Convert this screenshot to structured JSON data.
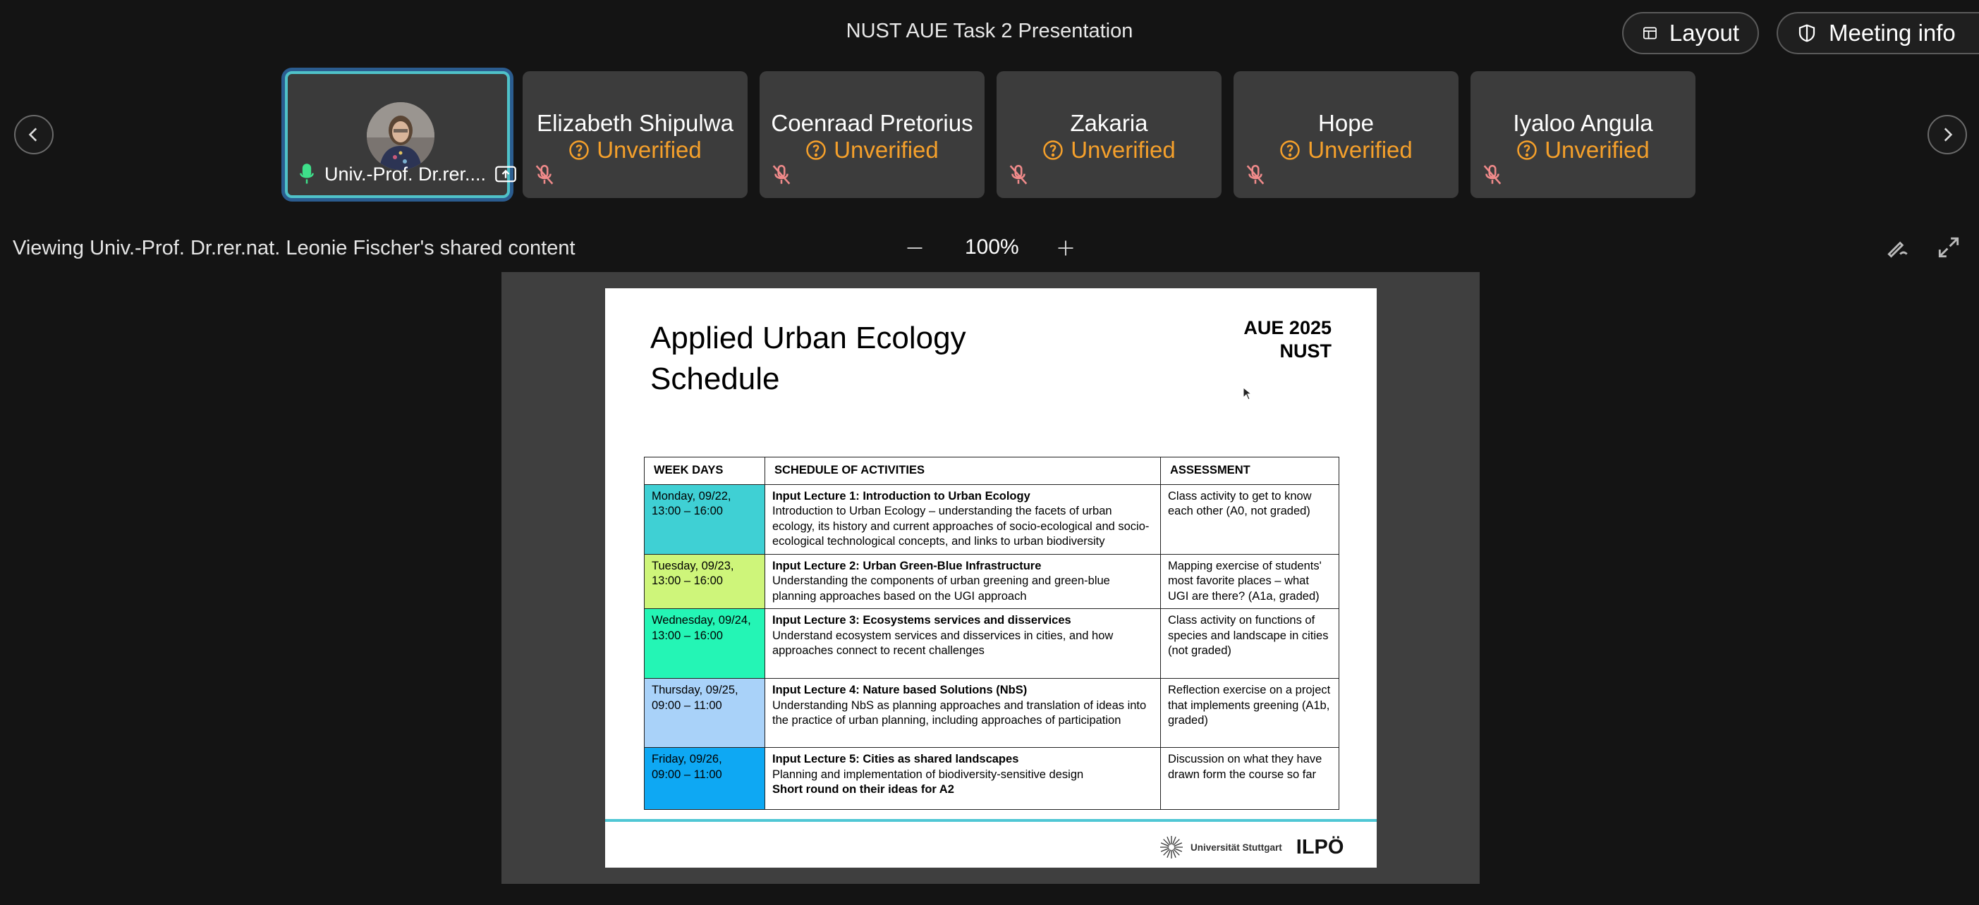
{
  "header": {
    "meeting_title": "NUST AUE Task 2 Presentation",
    "layout_label": "Layout",
    "meeting_info_label": "Meeting info"
  },
  "participants": [
    {
      "name": "Univ.-Prof. Dr.rer....",
      "status": "",
      "active": true
    },
    {
      "name": "Elizabeth Shipulwa",
      "status": "Unverified"
    },
    {
      "name": "Coenraad Pretorius",
      "status": "Unverified"
    },
    {
      "name": "Zakaria",
      "status": "Unverified"
    },
    {
      "name": "Hope",
      "status": "Unverified"
    },
    {
      "name": "Iyaloo Angula",
      "status": "Unverified"
    }
  ],
  "share_bar": {
    "viewing_text": "Viewing Univ.-Prof. Dr.rer.nat. Leonie Fischer's shared content",
    "zoom": "100%"
  },
  "slide": {
    "title_line1": "Applied Urban Ecology",
    "title_line2": "Schedule",
    "badge_line1": "AUE 2025",
    "badge_line2": "NUST",
    "table": {
      "headers": [
        "WEEK DAYS",
        "SCHEDULE OF ACTIVITIES",
        "ASSESSMENT"
      ],
      "rows": [
        {
          "day": "Monday, 09/22,",
          "time": "13:00 – 16:00",
          "color": "#3fd0d4",
          "activity_title": "Input Lecture 1: Introduction to Urban Ecology",
          "activity_text": "Introduction to Urban Ecology – understanding the facets of urban ecology, its history and current approaches of socio-ecological and socio-ecological technological concepts, and links to urban biodiversity",
          "activity_extra": "",
          "assessment": "Class activity to get to know each other (A0, not graded)"
        },
        {
          "day": "Tuesday, 09/23,",
          "time": "13:00 – 16:00",
          "color": "#cef57a",
          "activity_title": "Input Lecture 2: Urban Green-Blue Infrastructure",
          "activity_text": "Understanding the components of urban greening and green-blue planning approaches based on the UGI approach",
          "activity_extra": "",
          "assessment": "Mapping exercise of students' most favorite places – what UGI are there? (A1a, graded)"
        },
        {
          "day": "Wednesday, 09/24,",
          "time": "13:00 – 16:00",
          "color": "#24f5b5",
          "activity_title": "Input Lecture 3: Ecosystems services and disservices",
          "activity_text": "Understand ecosystem services and disservices in cities, and how approaches connect to recent challenges",
          "activity_extra": "",
          "assessment": "Class activity on functions of species and landscape in cities (not graded)"
        },
        {
          "day": "Thursday, 09/25,",
          "time": "09:00 – 11:00",
          "color": "#a9d2f9",
          "activity_title": "Input Lecture 4: Nature based Solutions (NbS)",
          "activity_text": "Understanding NbS as planning approaches and translation of ideas into the practice of urban planning, including approaches of participation",
          "activity_extra": "",
          "assessment": "Reflection exercise on a project that implements greening (A1b, graded)"
        },
        {
          "day": "Friday, 09/26,",
          "time": "09:00 – 11:00",
          "color": "#0ea8f3",
          "activity_title": "Input Lecture 5: Cities as shared landscapes",
          "activity_text": "Planning and implementation of biodiversity-sensitive design",
          "activity_extra": "Short round on their ideas for A2",
          "assessment": "Discussion on what they have drawn form the course so far"
        }
      ]
    },
    "footer": {
      "university": "Universität Stuttgart",
      "institute": "ILPÖ"
    }
  },
  "colors": {
    "background": "#141414",
    "tile": "#3c3c3c",
    "active_border": "#4fc2c9",
    "unverified": "#f5a02b",
    "muted_icon": "#f08a8a",
    "slide_rule": "#4fc7d4"
  },
  "icons": [
    "layout-icon",
    "shield-icon",
    "chevron-left-icon",
    "chevron-right-icon",
    "unverified-icon",
    "mic-off-icon",
    "mic-icon",
    "screen-share-icon",
    "zoom-out-icon",
    "zoom-in-icon",
    "annotate-icon",
    "fullscreen-icon"
  ]
}
